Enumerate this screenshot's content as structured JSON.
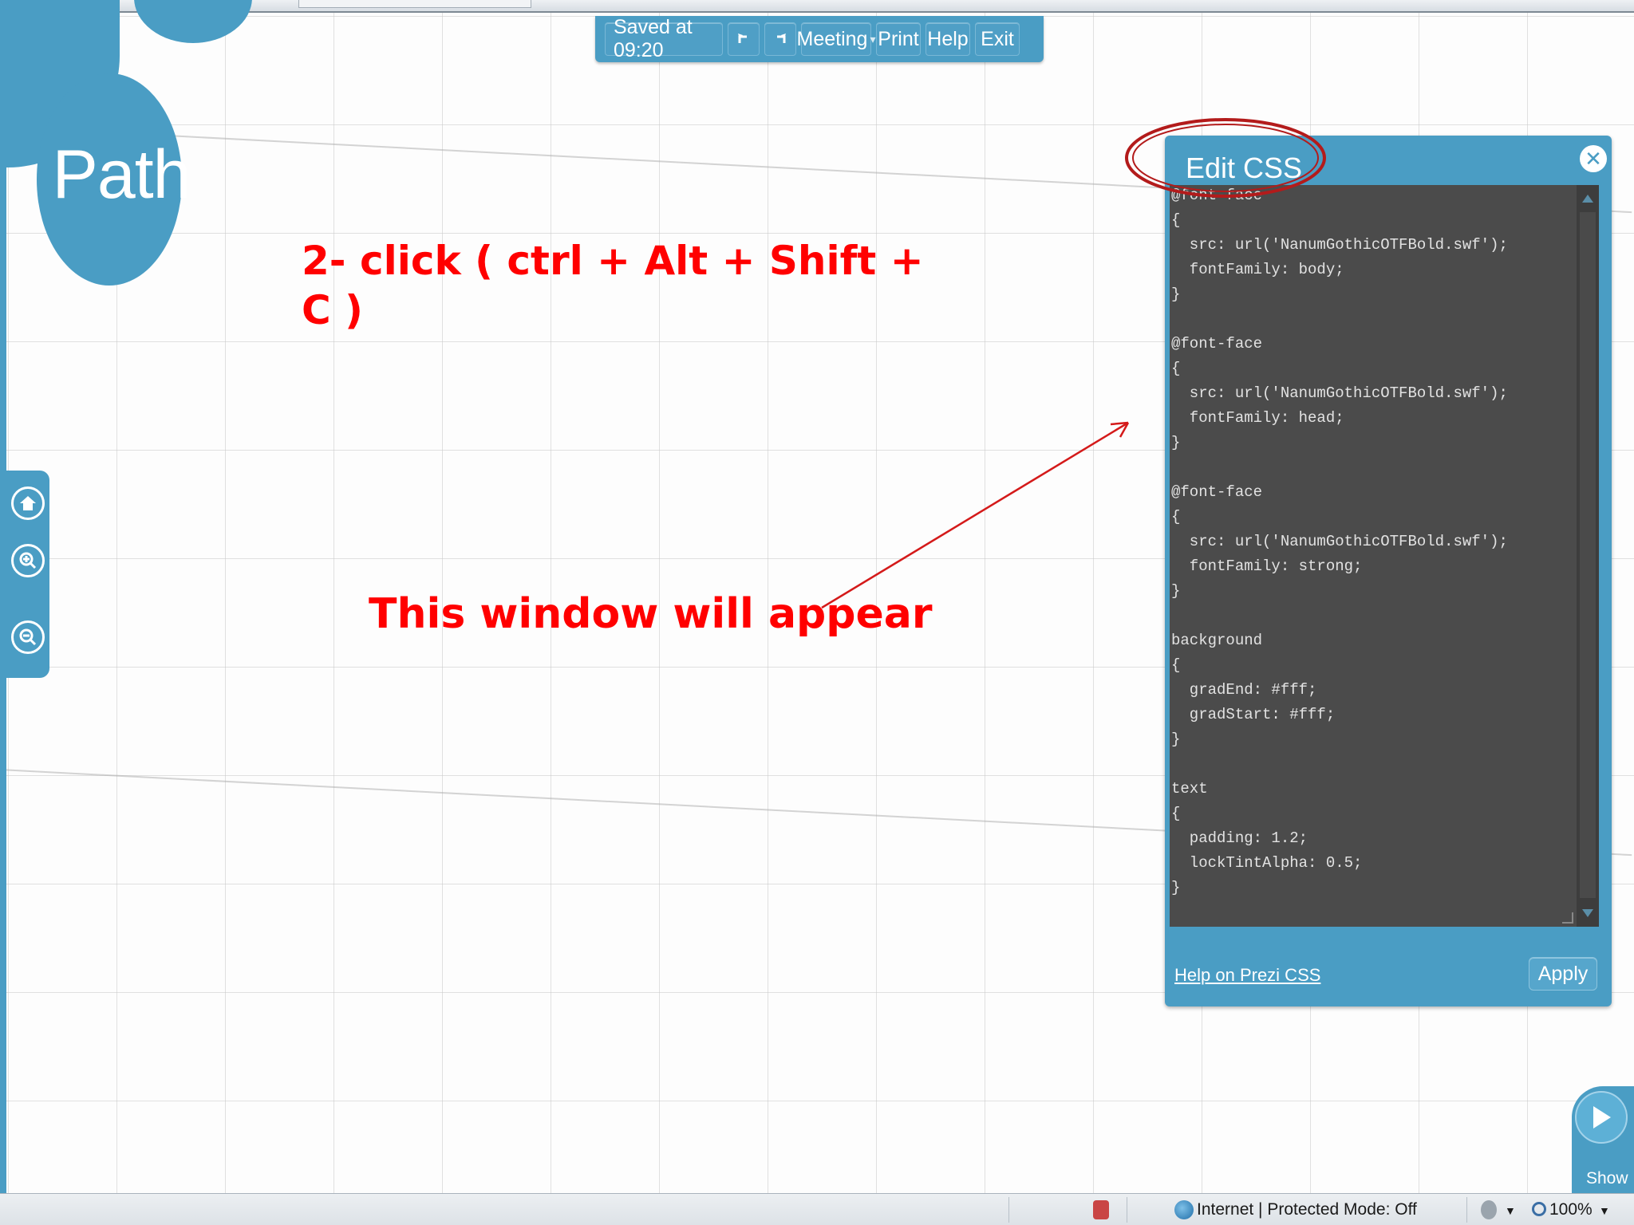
{
  "toolbar": {
    "saved_label": "Saved at 09:20",
    "meeting_label": "Meeting",
    "meeting_arrow": "▾",
    "print_label": "Print",
    "help_label": "Help",
    "exit_label": "Exit"
  },
  "path_label": "Path",
  "annotations": {
    "step_line1": "2- click  ( ctrl + Alt + Shift +",
    "step_line2": "C )",
    "window_note": "This window will appear"
  },
  "dialog": {
    "title": "Edit CSS",
    "code_lines": [
      "@font-face",
      "{",
      "  src: url('NanumGothicOTFBold.swf');",
      "  fontFamily: body;",
      "}",
      "",
      "@font-face",
      "{",
      "  src: url('NanumGothicOTFBold.swf');",
      "  fontFamily: head;",
      "}",
      "",
      "@font-face",
      "{",
      "  src: url('NanumGothicOTFBold.swf');",
      "  fontFamily: strong;",
      "}",
      "",
      "background",
      "{",
      "  gradEnd: #fff;",
      "  gradStart: #fff;",
      "}",
      "",
      "text",
      "{",
      "  padding: 1.2;",
      "  lockTintAlpha: 0.5;",
      "}"
    ],
    "help_link": "Help on Prezi CSS",
    "apply_label": "Apply"
  },
  "show_label": "Show",
  "status": {
    "zone_text": "Internet | Protected Mode: Off",
    "zoom_text": "100%"
  },
  "colors": {
    "prezi_blue": "#4a9dc4",
    "annotation_red": "#ff0000",
    "code_bg": "#4b4b4b"
  },
  "icons": [
    "undo-icon",
    "redo-icon",
    "home-icon",
    "zoom-in-icon",
    "zoom-out-icon",
    "close-icon",
    "play-icon",
    "globe-icon",
    "zoom-magnifier-icon"
  ]
}
